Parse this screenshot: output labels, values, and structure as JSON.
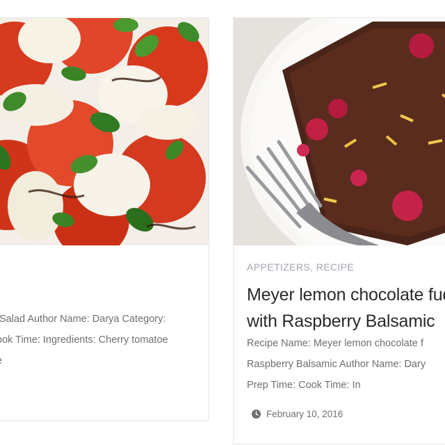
{
  "posts": [
    {
      "excerpt_lines": [
        "Salad Author Name: Darya Category:",
        "ook Time: Ingredients: Cherry tomatoe",
        "e"
      ],
      "image_icon": "caprese-salad-photo"
    },
    {
      "categories": [
        "APPETIZERS",
        "RECIPE"
      ],
      "category_separator": ",",
      "title_lines": [
        "Meyer lemon chocolate fud",
        "with Raspberry Balsamic"
      ],
      "excerpt_lines": [
        "Recipe Name: Meyer lemon chocolate f",
        "Raspberry Balsamic Author Name: Dary",
        "Prep Time: Cook Time: In"
      ],
      "date": "February 10, 2016",
      "date_icon": "clock-icon",
      "image_icon": "chocolate-fudge-photo"
    }
  ],
  "colors": {
    "meta": "#a3a3b5",
    "title": "#2a2a2a",
    "text": "#6f6f6f",
    "border": "#e6e6e6"
  }
}
